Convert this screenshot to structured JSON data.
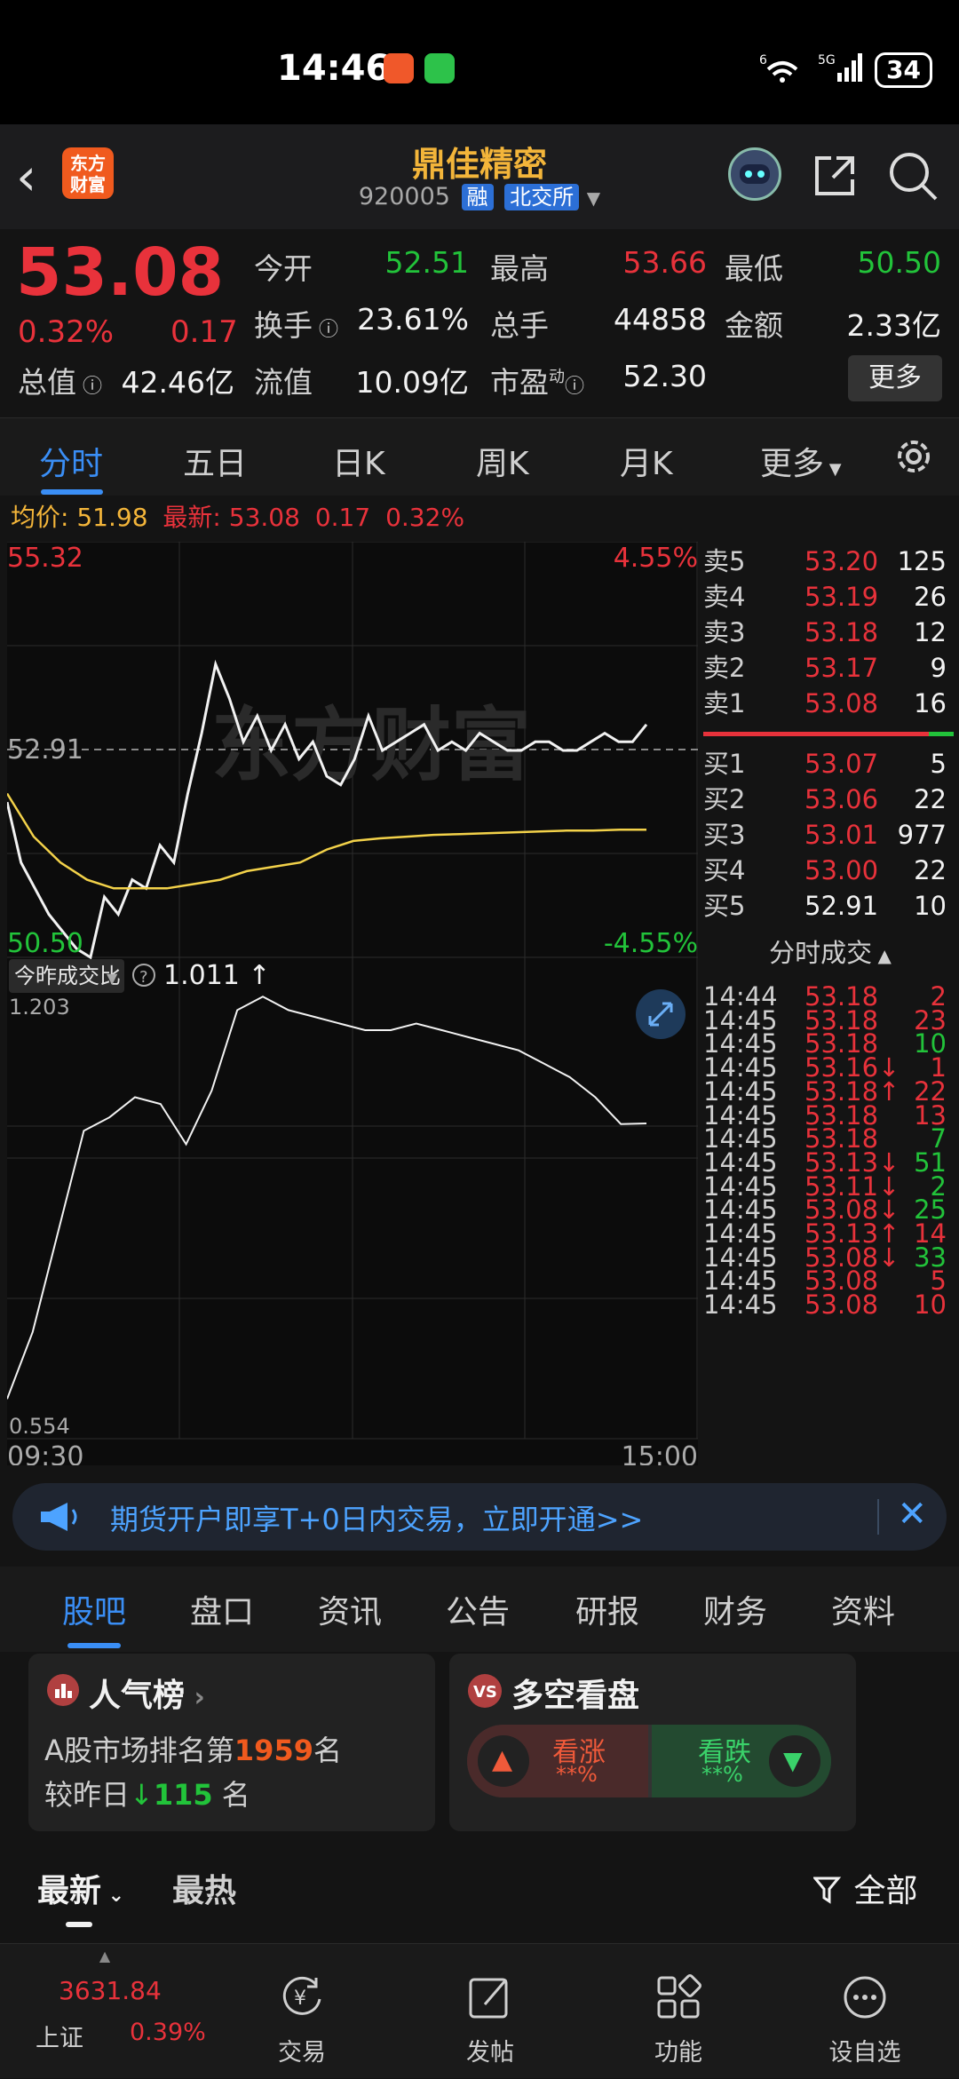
{
  "status": {
    "time": "14:46",
    "battery": "34",
    "network": "6",
    "net5g": "5G"
  },
  "header": {
    "logo_text": "东方财富",
    "stock_name": "鼎佳精密",
    "code": "920005",
    "tag1": "融",
    "tag2": "北交所"
  },
  "quote": {
    "price": "53.08",
    "pct": "0.32%",
    "change": "0.17",
    "open_label": "今开",
    "open": "52.51",
    "high_label": "最高",
    "high": "53.66",
    "low_label": "最低",
    "low": "50.50",
    "turnover_label": "换手",
    "turnover": "23.61%",
    "volume_label": "总手",
    "volume": "44858",
    "amount_label": "金额",
    "amount": "2.33亿",
    "mcap_label": "总值",
    "mcap": "42.46亿",
    "float_label": "流值",
    "float": "10.09亿",
    "pe_label": "市盈",
    "pe_sup": "动",
    "pe": "52.30",
    "more": "更多"
  },
  "chart_tabs": [
    "分时",
    "五日",
    "日K",
    "周K",
    "月K",
    "更多"
  ],
  "avg_bar": {
    "avg_label": "均价:",
    "avg": "51.98",
    "last_label": "最新:",
    "last": "53.08",
    "chg": "0.17",
    "pct": "0.32%"
  },
  "chart_labels": {
    "top_price": "55.32",
    "top_pct": "4.55%",
    "mid_price": "52.91",
    "bottom_price": "50.50",
    "bottom_pct": "-4.55%",
    "sub_label": "今昨成交比",
    "sub_value": "1.011",
    "sub_top": "1.203",
    "sub_bottom": "0.554",
    "t_start": "09:30",
    "t_end": "15:00",
    "watermark": "东方财富"
  },
  "chart_data": {
    "type": "line",
    "x": [
      "09:30",
      "15:00"
    ],
    "ylim": [
      50.5,
      55.32
    ],
    "ref": 52.91,
    "series": [
      {
        "values": [
          52.3,
          51.6,
          51.3,
          51.0,
          50.8,
          50.6,
          50.5,
          51.2,
          51.0,
          51.4,
          51.3,
          51.8,
          51.6,
          52.4,
          53.1,
          53.9,
          53.5,
          53.0,
          53.3,
          52.9,
          53.2,
          52.8,
          53.0,
          52.6,
          52.5,
          52.8,
          53.3,
          52.9,
          53.0,
          53.1,
          53.2,
          52.9,
          53.0,
          52.9,
          53.1,
          53.0,
          52.9,
          52.9,
          53.0,
          53.0,
          52.9,
          52.9,
          53.0,
          53.1,
          53.0,
          53.0,
          53.2
        ]
      },
      {
        "values": [
          52.4,
          51.9,
          51.6,
          51.4,
          51.3,
          51.3,
          51.3,
          51.35,
          51.4,
          51.5,
          51.55,
          51.6,
          51.75,
          51.85,
          51.88,
          51.9,
          51.92,
          51.93,
          51.94,
          51.95,
          51.96,
          51.97,
          51.97,
          51.98,
          51.98
        ]
      }
    ],
    "sub_series": {
      "ylim": [
        0.554,
        1.203
      ],
      "values": [
        0.6,
        0.7,
        0.85,
        1.0,
        1.02,
        1.05,
        1.04,
        0.98,
        1.06,
        1.18,
        1.2,
        1.18,
        1.17,
        1.16,
        1.15,
        1.15,
        1.16,
        1.15,
        1.14,
        1.13,
        1.12,
        1.1,
        1.08,
        1.05,
        1.01,
        1.011
      ]
    }
  },
  "order_book": {
    "sells": [
      {
        "l": "卖5",
        "p": "53.20",
        "v": "125"
      },
      {
        "l": "卖4",
        "p": "53.19",
        "v": "26"
      },
      {
        "l": "卖3",
        "p": "53.18",
        "v": "12"
      },
      {
        "l": "卖2",
        "p": "53.17",
        "v": "9"
      },
      {
        "l": "卖1",
        "p": "53.08",
        "v": "16"
      }
    ],
    "buys": [
      {
        "l": "买1",
        "p": "53.07",
        "v": "5"
      },
      {
        "l": "买2",
        "p": "53.06",
        "v": "22"
      },
      {
        "l": "买3",
        "p": "53.01",
        "v": "977"
      },
      {
        "l": "买4",
        "p": "53.00",
        "v": "22"
      },
      {
        "l": "买5",
        "p": "52.91",
        "v": "10"
      }
    ],
    "trades_title": "分时成交",
    "trades": [
      {
        "t": "14:44",
        "p": "53.18",
        "v": "2",
        "vc": "red"
      },
      {
        "t": "14:45",
        "p": "53.18",
        "v": "23",
        "vc": "red"
      },
      {
        "t": "14:45",
        "p": "53.18",
        "v": "10",
        "vc": "green"
      },
      {
        "t": "14:45",
        "p": "53.16↓",
        "v": "1",
        "vc": "red"
      },
      {
        "t": "14:45",
        "p": "53.18↑",
        "v": "22",
        "vc": "red"
      },
      {
        "t": "14:45",
        "p": "53.18",
        "v": "13",
        "vc": "red"
      },
      {
        "t": "14:45",
        "p": "53.18",
        "v": "7",
        "vc": "green"
      },
      {
        "t": "14:45",
        "p": "53.13↓",
        "v": "51",
        "vc": "green"
      },
      {
        "t": "14:45",
        "p": "53.11↓",
        "v": "2",
        "vc": "green"
      },
      {
        "t": "14:45",
        "p": "53.08↓",
        "v": "25",
        "vc": "green"
      },
      {
        "t": "14:45",
        "p": "53.13↑",
        "v": "14",
        "vc": "red"
      },
      {
        "t": "14:45",
        "p": "53.08↓",
        "v": "33",
        "vc": "green"
      },
      {
        "t": "14:45",
        "p": "53.08",
        "v": "5",
        "vc": "red"
      },
      {
        "t": "14:45",
        "p": "53.08",
        "v": "10",
        "vc": "red"
      }
    ]
  },
  "banner": {
    "text": "期货开户即享T+0日内交易，立即开通>>"
  },
  "section_tabs": [
    "股吧",
    "盘口",
    "资讯",
    "公告",
    "研报",
    "财务",
    "资料"
  ],
  "popularity": {
    "title": "人气榜",
    "l1_pre": "A股市场排名第",
    "rank": "1959",
    "l1_post": "名",
    "l2_pre": "较昨日",
    "delta": "115",
    "l2_post": " 名"
  },
  "long_short": {
    "title": "多空看盘",
    "up": "看涨",
    "up_pct": "**%",
    "down": "看跌",
    "down_pct": "**%"
  },
  "feed": {
    "latest": "最新",
    "hot": "最热",
    "filter": "全部"
  },
  "bottom_nav": {
    "index_value": "3631.84",
    "index_name": "上证",
    "index_pct": "0.39%",
    "trade": "交易",
    "post": "发帖",
    "func": "功能",
    "watch": "设自选"
  }
}
